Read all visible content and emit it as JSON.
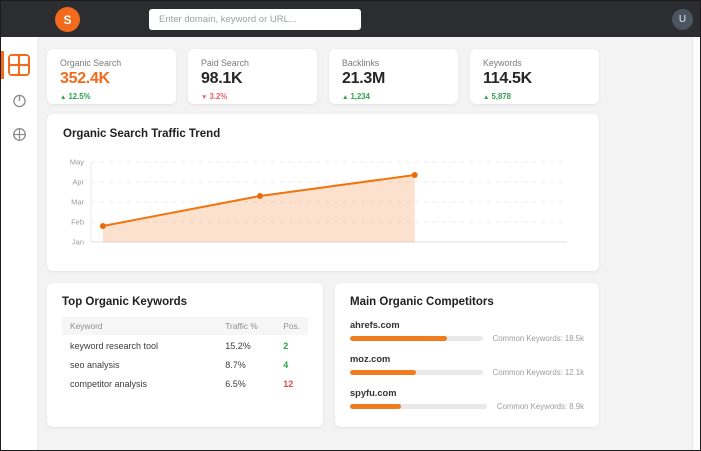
{
  "colors": {
    "accent_orange": "#f26a1b",
    "bar_orange": "#ef7d1e",
    "delta_up_green": "#2ea24f",
    "delta_down_red": "#ee5d6c",
    "position_red": "#e04b4b",
    "topbar_bg": "#2b2d30",
    "avatar_bg": "#4b5560"
  },
  "topbar": {
    "logo_letter": "S",
    "search_placeholder": "Enter domain, keyword or URL...",
    "avatar_letter": "U"
  },
  "sidebar": {
    "items": [
      {
        "name": "dashboard",
        "icon": "grid-icon",
        "active": true
      },
      {
        "name": "power",
        "icon": "power-icon",
        "active": false
      },
      {
        "name": "globe",
        "icon": "globe-icon",
        "active": false
      }
    ]
  },
  "stats": [
    {
      "label": "Organic Search",
      "value": "352.4K",
      "value_class": "orange",
      "arrow": "▲",
      "delta": "12.5%",
      "direction": "up"
    },
    {
      "label": "Paid Search",
      "value": "98.1K",
      "value_class": "dark",
      "arrow": "▼",
      "delta": "3.2%",
      "direction": "down"
    },
    {
      "label": "Backlinks",
      "value": "21.3M",
      "value_class": "dark",
      "arrow": "▲",
      "delta": "1,234",
      "direction": "up"
    },
    {
      "label": "Keywords",
      "value": "114.5K",
      "value_class": "dark",
      "arrow": "▲",
      "delta": "5,878",
      "direction": "up"
    }
  ],
  "chart_data": {
    "type": "area",
    "title": "Organic Search Traffic Trend",
    "y_tick_labels": [
      "May",
      "Apr",
      "Mar",
      "Feb",
      "Jan"
    ],
    "y_scale_note": "y values are tick units above Jan baseline (Jan=0, Feb=1, Mar=2, Apr=3, May=4)",
    "points": [
      {
        "x": 0.025,
        "y": 0.8
      },
      {
        "x": 0.355,
        "y": 2.3
      },
      {
        "x": 0.68,
        "y": 3.35
      }
    ],
    "grid": true,
    "legend": "none",
    "line_color": "#f2740e",
    "dot_color": "#e96a0a",
    "fill_color": "rgba(242,122,34,0.22)"
  },
  "keywords_card": {
    "title": "Top Organic Keywords",
    "columns": [
      "Keyword",
      "Traffic %",
      "Pos."
    ],
    "rows": [
      {
        "keyword": "keyword research tool",
        "traffic": "15.2%",
        "pos": "2",
        "pos_color": "green"
      },
      {
        "keyword": "seo analysis",
        "traffic": "8.7%",
        "pos": "4",
        "pos_color": "green"
      },
      {
        "keyword": "competitor analysis",
        "traffic": "6.5%",
        "pos": "12",
        "pos_color": "red"
      }
    ]
  },
  "competitors_card": {
    "title": "Main Organic Competitors",
    "items": [
      {
        "domain": "ahrefs.com",
        "bar_pct": 73,
        "label": "Common Keywords: 18.5k"
      },
      {
        "domain": "moz.com",
        "bar_pct": 50,
        "label": "Common Keywords: 12.1k"
      },
      {
        "domain": "spyfu.com",
        "bar_pct": 37,
        "label": "Common Keywords: 8.9k"
      }
    ]
  }
}
